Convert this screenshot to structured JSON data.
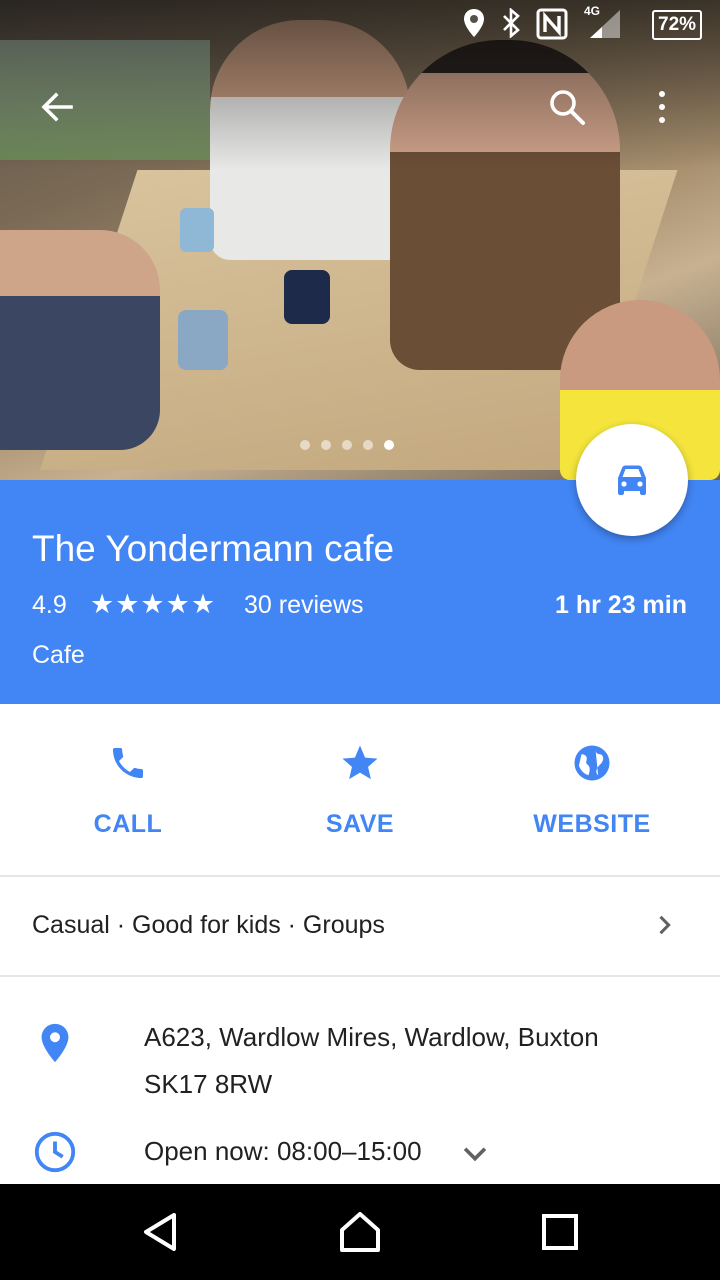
{
  "status_bar": {
    "network": "4G",
    "battery": "72%"
  },
  "photo": {
    "page_count": 5,
    "current_page": 5
  },
  "place": {
    "name": "The Yondermann cafe",
    "rating": "4.9",
    "stars": "★★★★★",
    "reviews": "30 reviews",
    "drive_time": "1 hr 23 min",
    "category": "Cafe"
  },
  "actions": [
    {
      "label": "CALL",
      "icon": "phone-icon"
    },
    {
      "label": "SAVE",
      "icon": "star-icon"
    },
    {
      "label": "WEBSITE",
      "icon": "globe-icon"
    }
  ],
  "attributes": "Casual · Good for kids · Groups",
  "address": {
    "line1": "A623, Wardlow Mires, Wardlow, Buxton",
    "line2": "SK17 8RW"
  },
  "hours": "Open now: 08:00–15:00",
  "colors": {
    "accent": "#4285f4",
    "text": "#212121"
  }
}
